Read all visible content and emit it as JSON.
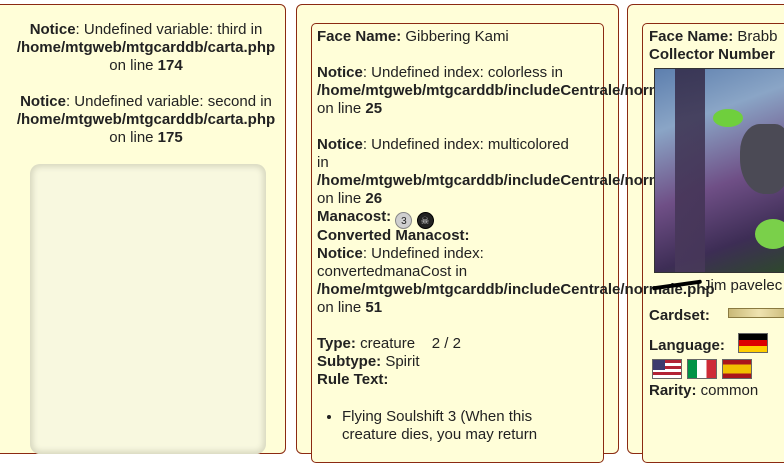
{
  "left": {
    "notice1": {
      "label": "Notice",
      "text": ": Undefined variable: third in",
      "path": "/home/mtgweb/mtgcarddb/carta.php",
      "online": "on line ",
      "line": "174"
    },
    "notice2": {
      "label": "Notice",
      "text": ": Undefined variable: second in",
      "path": "/home/mtgweb/mtgcarddb/carta.php",
      "online": "on line ",
      "line": "175"
    }
  },
  "mid": {
    "face_label": "Face Name:",
    "face_value": " Gibbering Kami",
    "n1": {
      "label": "Notice",
      "text": ": Undefined index: colorless in",
      "path": "/home/mtgweb/mtgcarddb/includeCentrale/normale.php",
      "online": "on line ",
      "line": "25"
    },
    "n2": {
      "label": "Notice",
      "text1": ": Undefined index: multicolored",
      "text2": "in",
      "path": "/home/mtgweb/mtgcarddb/includeCentrale/normale.php",
      "online": "on line ",
      "line": "26"
    },
    "manacost_label": "Manacost:",
    "mana_symbols": [
      "3",
      "black-mana"
    ],
    "cmc_label": "Converted Manacost:",
    "n3": {
      "label": "Notice",
      "text1": ": Undefined index:",
      "text2": "convertedmanaCost in",
      "path": "/home/mtgweb/mtgcarddb/includeCentrale/normale.php",
      "online": "on line ",
      "line": "51"
    },
    "type_label": "Type:",
    "type_value": " creature    2 / 2",
    "subtype_label": "Subtype:",
    "subtype_value": " Spirit",
    "ruletext_label": "Rule Text:",
    "rule1": "Flying Soulshift 3 (When this",
    "rule2": "creature dies, you may return"
  },
  "right": {
    "face_label": "Face Name:",
    "face_value": " Brabb",
    "collector_label": "Collector Number",
    "artist": "Jim pavelec",
    "cardset_label": "Cardset:",
    "language_label": "Language:",
    "languages": [
      "de-flag",
      "us-flag",
      "it-flag",
      "es-flag"
    ],
    "rarity_label": "Rarity:",
    "rarity_value": " common"
  }
}
